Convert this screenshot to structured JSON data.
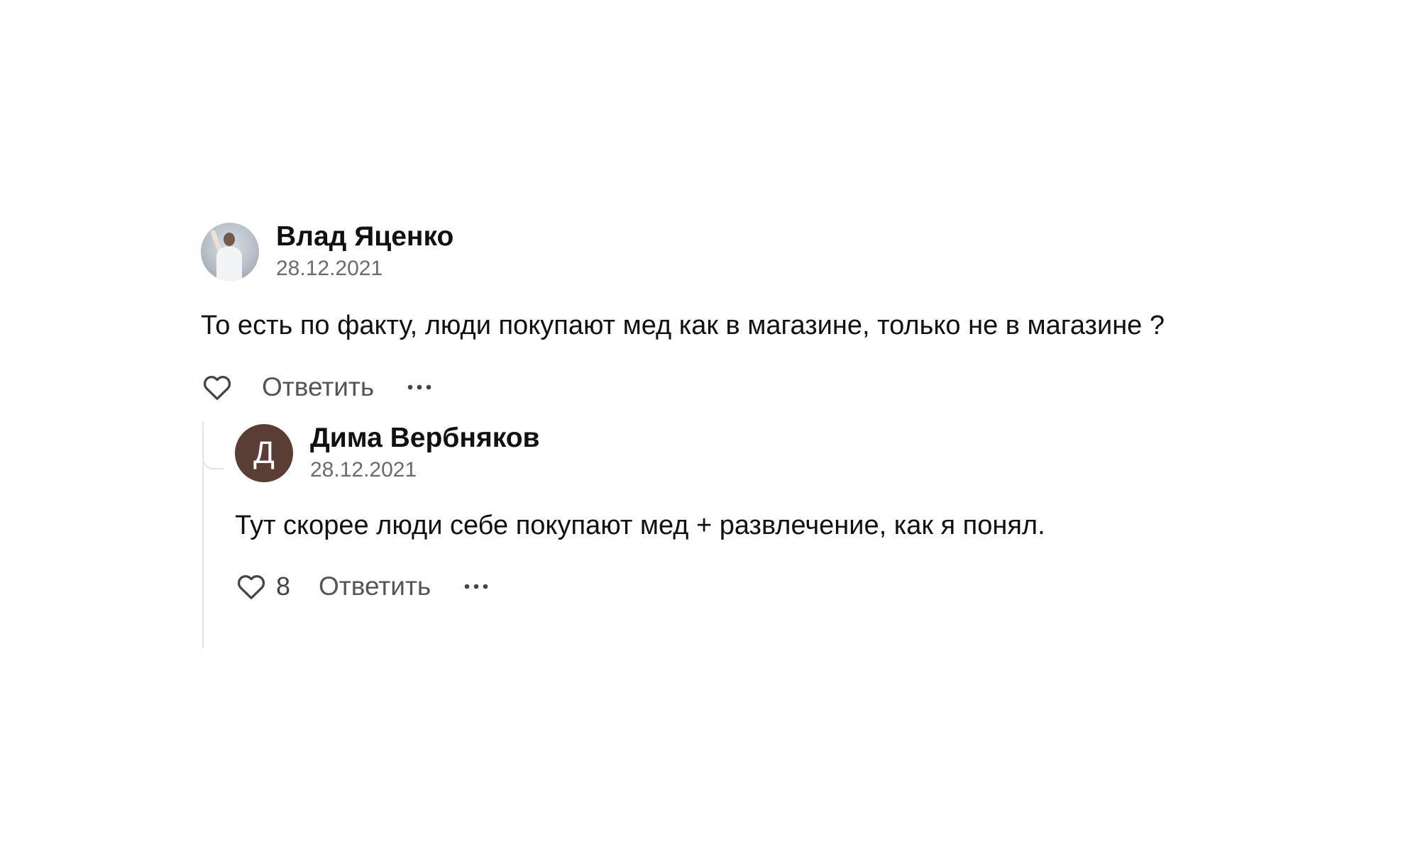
{
  "comment": {
    "author": "Влад Яценко",
    "date": "28.12.2021",
    "text": "То есть по факту, люди покупают мед как в магазине, только не в магазине ?",
    "reply_label": "Ответить",
    "icons": {
      "avatar": "user-photo",
      "like": "heart-icon",
      "more": "more-dots-icon"
    }
  },
  "reply": {
    "author": "Дима Вербняков",
    "avatar_letter": "Д",
    "avatar_color": "#5a3e36",
    "date": "28.12.2021",
    "text": "Тут скорее люди себе покупают мед + развлечение, как я понял.",
    "likes": "8",
    "reply_label": "Ответить",
    "icons": {
      "like": "heart-icon",
      "more": "more-dots-icon"
    }
  }
}
